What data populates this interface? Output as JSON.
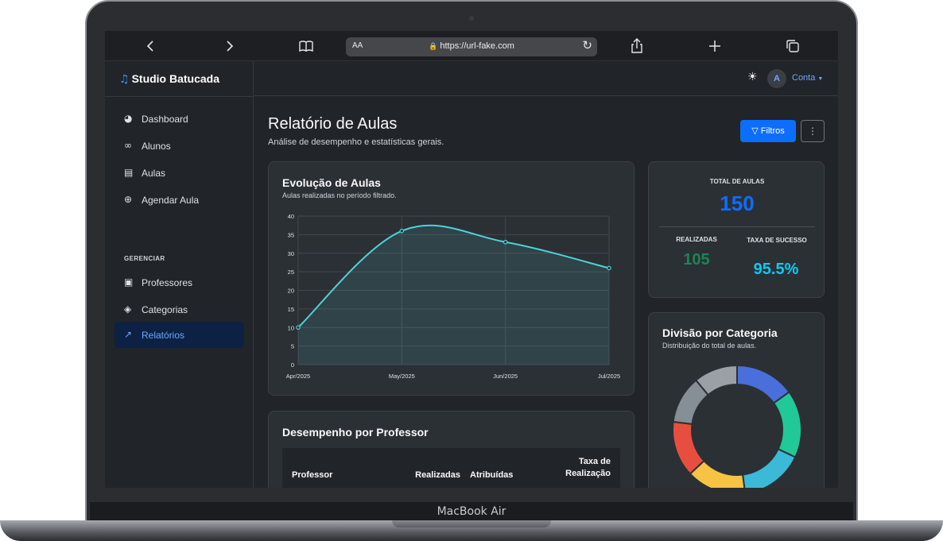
{
  "device": {
    "label": "MacBook Air"
  },
  "browser": {
    "url": "https://url-fake.com",
    "text_size_label": "AA",
    "icons": [
      "chevron-left-icon",
      "chevron-right-icon",
      "book-icon",
      "lock-icon",
      "reload-icon",
      "share-icon",
      "plus-icon",
      "tabs-icon"
    ]
  },
  "brand": {
    "name": "Studio Batucada",
    "icon": "music-note-icon"
  },
  "sidebar": {
    "items": [
      {
        "label": "Dashboard",
        "icon": "speedometer-icon"
      },
      {
        "label": "Alunos",
        "icon": "people-icon"
      },
      {
        "label": "Aulas",
        "icon": "list-icon"
      },
      {
        "label": "Agendar Aula",
        "icon": "plus-circle-icon"
      }
    ],
    "section_heading": "GERENCIAR",
    "manage_items": [
      {
        "label": "Professores",
        "icon": "easel-icon"
      },
      {
        "label": "Categorias",
        "icon": "tag-icon"
      },
      {
        "label": "Relatórios",
        "icon": "graph-icon",
        "active": true
      }
    ]
  },
  "topbar": {
    "theme_icon": "sun-icon",
    "avatar_initial": "A",
    "account_label": "Conta"
  },
  "page": {
    "title": "Relatório de Aulas",
    "subtitle": "Análise de desempenho e estatísticas gerais.",
    "filter_button": "Filtros",
    "more_button": "⋮"
  },
  "evolution_card": {
    "title": "Evolução de Aulas",
    "subtitle": "Aulas realizadas no período filtrado."
  },
  "chart_data": [
    {
      "type": "area",
      "title": "Evolução de Aulas",
      "x": [
        "Apr/2025",
        "May/2025",
        "Jun/2025",
        "Jul/2025"
      ],
      "values": [
        10,
        36,
        33,
        26
      ],
      "ylim": [
        0,
        40
      ],
      "yticks": [
        0,
        5,
        10,
        15,
        20,
        25,
        30,
        35,
        40
      ],
      "grid": true,
      "color": "#4fd1d9"
    },
    {
      "type": "pie",
      "title": "Divisão por Categoria",
      "donut": true,
      "values": [
        15,
        17,
        16,
        15,
        14,
        12,
        11
      ],
      "colors": [
        "#4a6fdc",
        "#20c997",
        "#3bb9d6",
        "#f6c343",
        "#e84e40",
        "#868e96",
        "#9aa0a6"
      ]
    }
  ],
  "stats": {
    "total_label": "TOTAL DE AULAS",
    "total_value": "150",
    "done_label": "REALIZADAS",
    "done_value": "105",
    "rate_label": "TAXA DE SUCESSO",
    "rate_value": "95.5%",
    "colors": {
      "total": "#0d6efd",
      "done": "#198754",
      "rate": "#0dcaf0"
    }
  },
  "category_card": {
    "title": "Divisão por Categoria",
    "subtitle": "Distribuição do total de aulas."
  },
  "performance_card": {
    "title": "Desempenho por Professor",
    "columns": [
      "Professor",
      "Realizadas",
      "Atribuídas",
      "Taxa de Realização"
    ]
  }
}
